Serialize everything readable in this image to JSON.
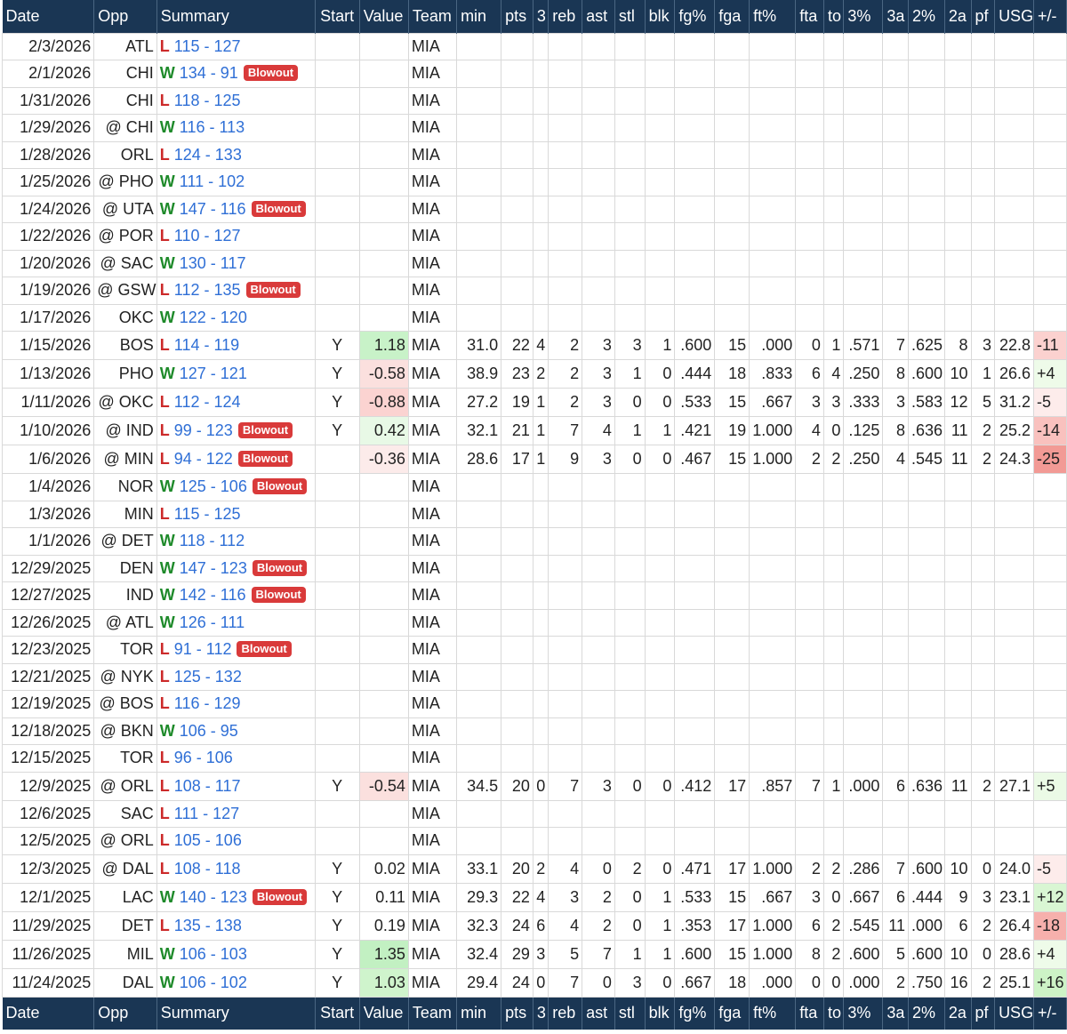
{
  "headers": [
    "Date",
    "Opp",
    "Summary",
    "Start",
    "Value",
    "Team",
    "min",
    "pts",
    "3",
    "reb",
    "ast",
    "stl",
    "blk",
    "fg%",
    "fga",
    "ft%",
    "fta",
    "to",
    "3%",
    "3a",
    "2%",
    "2a",
    "pf",
    "USG",
    "+/-"
  ],
  "colors": {
    "header_bg": "#1a3654",
    "win": "#1e8a2a",
    "loss": "#cc2a2a",
    "score": "#2f6fd6",
    "badge": "#d93a3a"
  },
  "games": [
    {
      "date": "2/3/2026",
      "opp": "ATL",
      "wl": "L",
      "score": "115 - 127",
      "badge": "",
      "start": "",
      "value": "",
      "team": "MIA",
      "min": "",
      "pts": "",
      "three": "",
      "reb": "",
      "ast": "",
      "stl": "",
      "blk": "",
      "fgp": "",
      "fga": "",
      "ftp": "",
      "fta": "",
      "to": "",
      "p3": "",
      "a3": "",
      "p2": "",
      "a2": "",
      "pf": "",
      "usg": "",
      "pm": ""
    },
    {
      "date": "2/1/2026",
      "opp": "CHI",
      "wl": "W",
      "score": "134 - 91",
      "badge": "Blowout",
      "start": "",
      "value": "",
      "team": "MIA",
      "min": "",
      "pts": "",
      "three": "",
      "reb": "",
      "ast": "",
      "stl": "",
      "blk": "",
      "fgp": "",
      "fga": "",
      "ftp": "",
      "fta": "",
      "to": "",
      "p3": "",
      "a3": "",
      "p2": "",
      "a2": "",
      "pf": "",
      "usg": "",
      "pm": ""
    },
    {
      "date": "1/31/2026",
      "opp": "CHI",
      "wl": "L",
      "score": "118 - 125",
      "badge": "",
      "start": "",
      "value": "",
      "team": "MIA",
      "min": "",
      "pts": "",
      "three": "",
      "reb": "",
      "ast": "",
      "stl": "",
      "blk": "",
      "fgp": "",
      "fga": "",
      "ftp": "",
      "fta": "",
      "to": "",
      "p3": "",
      "a3": "",
      "p2": "",
      "a2": "",
      "pf": "",
      "usg": "",
      "pm": ""
    },
    {
      "date": "1/29/2026",
      "opp": "@ CHI",
      "wl": "W",
      "score": "116 - 113",
      "badge": "",
      "start": "",
      "value": "",
      "team": "MIA",
      "min": "",
      "pts": "",
      "three": "",
      "reb": "",
      "ast": "",
      "stl": "",
      "blk": "",
      "fgp": "",
      "fga": "",
      "ftp": "",
      "fta": "",
      "to": "",
      "p3": "",
      "a3": "",
      "p2": "",
      "a2": "",
      "pf": "",
      "usg": "",
      "pm": ""
    },
    {
      "date": "1/28/2026",
      "opp": "ORL",
      "wl": "L",
      "score": "124 - 133",
      "badge": "",
      "start": "",
      "value": "",
      "team": "MIA",
      "min": "",
      "pts": "",
      "three": "",
      "reb": "",
      "ast": "",
      "stl": "",
      "blk": "",
      "fgp": "",
      "fga": "",
      "ftp": "",
      "fta": "",
      "to": "",
      "p3": "",
      "a3": "",
      "p2": "",
      "a2": "",
      "pf": "",
      "usg": "",
      "pm": ""
    },
    {
      "date": "1/25/2026",
      "opp": "@ PHO",
      "wl": "W",
      "score": "111 - 102",
      "badge": "",
      "start": "",
      "value": "",
      "team": "MIA",
      "min": "",
      "pts": "",
      "three": "",
      "reb": "",
      "ast": "",
      "stl": "",
      "blk": "",
      "fgp": "",
      "fga": "",
      "ftp": "",
      "fta": "",
      "to": "",
      "p3": "",
      "a3": "",
      "p2": "",
      "a2": "",
      "pf": "",
      "usg": "",
      "pm": ""
    },
    {
      "date": "1/24/2026",
      "opp": "@ UTA",
      "wl": "W",
      "score": "147 - 116",
      "badge": "Blowout",
      "start": "",
      "value": "",
      "team": "MIA",
      "min": "",
      "pts": "",
      "three": "",
      "reb": "",
      "ast": "",
      "stl": "",
      "blk": "",
      "fgp": "",
      "fga": "",
      "ftp": "",
      "fta": "",
      "to": "",
      "p3": "",
      "a3": "",
      "p2": "",
      "a2": "",
      "pf": "",
      "usg": "",
      "pm": ""
    },
    {
      "date": "1/22/2026",
      "opp": "@ POR",
      "wl": "L",
      "score": "110 - 127",
      "badge": "",
      "start": "",
      "value": "",
      "team": "MIA",
      "min": "",
      "pts": "",
      "three": "",
      "reb": "",
      "ast": "",
      "stl": "",
      "blk": "",
      "fgp": "",
      "fga": "",
      "ftp": "",
      "fta": "",
      "to": "",
      "p3": "",
      "a3": "",
      "p2": "",
      "a2": "",
      "pf": "",
      "usg": "",
      "pm": ""
    },
    {
      "date": "1/20/2026",
      "opp": "@ SAC",
      "wl": "W",
      "score": "130 - 117",
      "badge": "",
      "start": "",
      "value": "",
      "team": "MIA",
      "min": "",
      "pts": "",
      "three": "",
      "reb": "",
      "ast": "",
      "stl": "",
      "blk": "",
      "fgp": "",
      "fga": "",
      "ftp": "",
      "fta": "",
      "to": "",
      "p3": "",
      "a3": "",
      "p2": "",
      "a2": "",
      "pf": "",
      "usg": "",
      "pm": ""
    },
    {
      "date": "1/19/2026",
      "opp": "@ GSW",
      "wl": "L",
      "score": "112 - 135",
      "badge": "Blowout",
      "start": "",
      "value": "",
      "team": "MIA",
      "min": "",
      "pts": "",
      "three": "",
      "reb": "",
      "ast": "",
      "stl": "",
      "blk": "",
      "fgp": "",
      "fga": "",
      "ftp": "",
      "fta": "",
      "to": "",
      "p3": "",
      "a3": "",
      "p2": "",
      "a2": "",
      "pf": "",
      "usg": "",
      "pm": ""
    },
    {
      "date": "1/17/2026",
      "opp": "OKC",
      "wl": "W",
      "score": "122 - 120",
      "badge": "",
      "start": "",
      "value": "",
      "team": "MIA",
      "min": "",
      "pts": "",
      "three": "",
      "reb": "",
      "ast": "",
      "stl": "",
      "blk": "",
      "fgp": "",
      "fga": "",
      "ftp": "",
      "fta": "",
      "to": "",
      "p3": "",
      "a3": "",
      "p2": "",
      "a2": "",
      "pf": "",
      "usg": "",
      "pm": ""
    },
    {
      "date": "1/15/2026",
      "opp": "BOS",
      "wl": "L",
      "score": "114 - 119",
      "badge": "",
      "start": "Y",
      "value": "1.18",
      "value_bg": "#c8f2c8",
      "team": "MIA",
      "min": "31.0",
      "pts": "22",
      "three": "4",
      "reb": "2",
      "ast": "3",
      "stl": "3",
      "blk": "1",
      "fgp": ".600",
      "fga": "15",
      "ftp": ".000",
      "fta": "0",
      "to": "1",
      "p3": ".571",
      "a3": "7",
      "p2": ".625",
      "a2": "8",
      "pf": "3",
      "usg": "22.8",
      "pm": "-11",
      "pm_bg": "#fbd1cf"
    },
    {
      "date": "1/13/2026",
      "opp": "PHO",
      "wl": "W",
      "score": "127 - 121",
      "badge": "",
      "start": "Y",
      "value": "-0.58",
      "value_bg": "#fbe0de",
      "team": "MIA",
      "min": "38.9",
      "pts": "23",
      "three": "2",
      "reb": "2",
      "ast": "3",
      "stl": "1",
      "blk": "0",
      "fgp": ".444",
      "fga": "18",
      "ftp": ".833",
      "fta": "6",
      "to": "4",
      "p3": ".250",
      "a3": "8",
      "p2": ".600",
      "a2": "10",
      "pf": "1",
      "usg": "26.6",
      "pm": "+4",
      "pm_bg": "#eefbe9"
    },
    {
      "date": "1/11/2026",
      "opp": "@ OKC",
      "wl": "L",
      "score": "112 - 124",
      "badge": "",
      "start": "Y",
      "value": "-0.88",
      "value_bg": "#fbd3d1",
      "team": "MIA",
      "min": "27.2",
      "pts": "19",
      "three": "1",
      "reb": "2",
      "ast": "3",
      "stl": "0",
      "blk": "0",
      "fgp": ".533",
      "fga": "15",
      "ftp": ".667",
      "fta": "3",
      "to": "3",
      "p3": ".333",
      "a3": "3",
      "p2": ".583",
      "a2": "12",
      "pf": "5",
      "usg": "31.2",
      "pm": "-5",
      "pm_bg": "#fdeceb"
    },
    {
      "date": "1/10/2026",
      "opp": "@ IND",
      "wl": "L",
      "score": "99 - 123",
      "badge": "Blowout",
      "start": "Y",
      "value": "0.42",
      "value_bg": "#e8f9e6",
      "team": "MIA",
      "min": "32.1",
      "pts": "21",
      "three": "1",
      "reb": "7",
      "ast": "4",
      "stl": "1",
      "blk": "1",
      "fgp": ".421",
      "fga": "19",
      "ftp": "1.000",
      "fta": "4",
      "to": "0",
      "p3": ".125",
      "a3": "8",
      "p2": ".636",
      "a2": "11",
      "pf": "2",
      "usg": "25.2",
      "pm": "-14",
      "pm_bg": "#f9c1be"
    },
    {
      "date": "1/6/2026",
      "opp": "@ MIN",
      "wl": "L",
      "score": "94 - 122",
      "badge": "Blowout",
      "start": "",
      "value": "-0.36",
      "value_bg": "#fcebea",
      "team": "MIA",
      "min": "28.6",
      "pts": "17",
      "three": "1",
      "reb": "9",
      "ast": "3",
      "stl": "0",
      "blk": "0",
      "fgp": ".467",
      "fga": "15",
      "ftp": "1.000",
      "fta": "2",
      "to": "2",
      "p3": ".250",
      "a3": "4",
      "p2": ".545",
      "a2": "11",
      "pf": "2",
      "usg": "24.3",
      "pm": "-25",
      "pm_bg": "#f29a95"
    },
    {
      "date": "1/4/2026",
      "opp": "NOR",
      "wl": "W",
      "score": "125 - 106",
      "badge": "Blowout",
      "start": "",
      "value": "",
      "team": "MIA",
      "min": "",
      "pts": "",
      "three": "",
      "reb": "",
      "ast": "",
      "stl": "",
      "blk": "",
      "fgp": "",
      "fga": "",
      "ftp": "",
      "fta": "",
      "to": "",
      "p3": "",
      "a3": "",
      "p2": "",
      "a2": "",
      "pf": "",
      "usg": "",
      "pm": ""
    },
    {
      "date": "1/3/2026",
      "opp": "MIN",
      "wl": "L",
      "score": "115 - 125",
      "badge": "",
      "start": "",
      "value": "",
      "team": "MIA",
      "min": "",
      "pts": "",
      "three": "",
      "reb": "",
      "ast": "",
      "stl": "",
      "blk": "",
      "fgp": "",
      "fga": "",
      "ftp": "",
      "fta": "",
      "to": "",
      "p3": "",
      "a3": "",
      "p2": "",
      "a2": "",
      "pf": "",
      "usg": "",
      "pm": ""
    },
    {
      "date": "1/1/2026",
      "opp": "@ DET",
      "wl": "W",
      "score": "118 - 112",
      "badge": "",
      "start": "",
      "value": "",
      "team": "MIA",
      "min": "",
      "pts": "",
      "three": "",
      "reb": "",
      "ast": "",
      "stl": "",
      "blk": "",
      "fgp": "",
      "fga": "",
      "ftp": "",
      "fta": "",
      "to": "",
      "p3": "",
      "a3": "",
      "p2": "",
      "a2": "",
      "pf": "",
      "usg": "",
      "pm": ""
    },
    {
      "date": "12/29/2025",
      "opp": "DEN",
      "wl": "W",
      "score": "147 - 123",
      "badge": "Blowout",
      "start": "",
      "value": "",
      "team": "MIA",
      "min": "",
      "pts": "",
      "three": "",
      "reb": "",
      "ast": "",
      "stl": "",
      "blk": "",
      "fgp": "",
      "fga": "",
      "ftp": "",
      "fta": "",
      "to": "",
      "p3": "",
      "a3": "",
      "p2": "",
      "a2": "",
      "pf": "",
      "usg": "",
      "pm": ""
    },
    {
      "date": "12/27/2025",
      "opp": "IND",
      "wl": "W",
      "score": "142 - 116",
      "badge": "Blowout",
      "start": "",
      "value": "",
      "team": "MIA",
      "min": "",
      "pts": "",
      "three": "",
      "reb": "",
      "ast": "",
      "stl": "",
      "blk": "",
      "fgp": "",
      "fga": "",
      "ftp": "",
      "fta": "",
      "to": "",
      "p3": "",
      "a3": "",
      "p2": "",
      "a2": "",
      "pf": "",
      "usg": "",
      "pm": ""
    },
    {
      "date": "12/26/2025",
      "opp": "@ ATL",
      "wl": "W",
      "score": "126 - 111",
      "badge": "",
      "start": "",
      "value": "",
      "team": "MIA",
      "min": "",
      "pts": "",
      "three": "",
      "reb": "",
      "ast": "",
      "stl": "",
      "blk": "",
      "fgp": "",
      "fga": "",
      "ftp": "",
      "fta": "",
      "to": "",
      "p3": "",
      "a3": "",
      "p2": "",
      "a2": "",
      "pf": "",
      "usg": "",
      "pm": ""
    },
    {
      "date": "12/23/2025",
      "opp": "TOR",
      "wl": "L",
      "score": "91 - 112",
      "badge": "Blowout",
      "start": "",
      "value": "",
      "team": "MIA",
      "min": "",
      "pts": "",
      "three": "",
      "reb": "",
      "ast": "",
      "stl": "",
      "blk": "",
      "fgp": "",
      "fga": "",
      "ftp": "",
      "fta": "",
      "to": "",
      "p3": "",
      "a3": "",
      "p2": "",
      "a2": "",
      "pf": "",
      "usg": "",
      "pm": ""
    },
    {
      "date": "12/21/2025",
      "opp": "@ NYK",
      "wl": "L",
      "score": "125 - 132",
      "badge": "",
      "start": "",
      "value": "",
      "team": "MIA",
      "min": "",
      "pts": "",
      "three": "",
      "reb": "",
      "ast": "",
      "stl": "",
      "blk": "",
      "fgp": "",
      "fga": "",
      "ftp": "",
      "fta": "",
      "to": "",
      "p3": "",
      "a3": "",
      "p2": "",
      "a2": "",
      "pf": "",
      "usg": "",
      "pm": ""
    },
    {
      "date": "12/19/2025",
      "opp": "@ BOS",
      "wl": "L",
      "score": "116 - 129",
      "badge": "",
      "start": "",
      "value": "",
      "team": "MIA",
      "min": "",
      "pts": "",
      "three": "",
      "reb": "",
      "ast": "",
      "stl": "",
      "blk": "",
      "fgp": "",
      "fga": "",
      "ftp": "",
      "fta": "",
      "to": "",
      "p3": "",
      "a3": "",
      "p2": "",
      "a2": "",
      "pf": "",
      "usg": "",
      "pm": ""
    },
    {
      "date": "12/18/2025",
      "opp": "@ BKN",
      "wl": "W",
      "score": "106 - 95",
      "badge": "",
      "start": "",
      "value": "",
      "team": "MIA",
      "min": "",
      "pts": "",
      "three": "",
      "reb": "",
      "ast": "",
      "stl": "",
      "blk": "",
      "fgp": "",
      "fga": "",
      "ftp": "",
      "fta": "",
      "to": "",
      "p3": "",
      "a3": "",
      "p2": "",
      "a2": "",
      "pf": "",
      "usg": "",
      "pm": ""
    },
    {
      "date": "12/15/2025",
      "opp": "TOR",
      "wl": "L",
      "score": "96 - 106",
      "badge": "",
      "start": "",
      "value": "",
      "team": "MIA",
      "min": "",
      "pts": "",
      "three": "",
      "reb": "",
      "ast": "",
      "stl": "",
      "blk": "",
      "fgp": "",
      "fga": "",
      "ftp": "",
      "fta": "",
      "to": "",
      "p3": "",
      "a3": "",
      "p2": "",
      "a2": "",
      "pf": "",
      "usg": "",
      "pm": ""
    },
    {
      "date": "12/9/2025",
      "opp": "@ ORL",
      "wl": "L",
      "score": "108 - 117",
      "badge": "",
      "start": "Y",
      "value": "-0.54",
      "value_bg": "#fbe0de",
      "team": "MIA",
      "min": "34.5",
      "pts": "20",
      "three": "0",
      "reb": "7",
      "ast": "3",
      "stl": "0",
      "blk": "0",
      "fgp": ".412",
      "fga": "17",
      "ftp": ".857",
      "fta": "7",
      "to": "1",
      "p3": ".000",
      "a3": "6",
      "p2": ".636",
      "a2": "11",
      "pf": "2",
      "usg": "27.1",
      "pm": "+5",
      "pm_bg": "#ebfae6"
    },
    {
      "date": "12/6/2025",
      "opp": "SAC",
      "wl": "L",
      "score": "111 - 127",
      "badge": "",
      "start": "",
      "value": "",
      "team": "MIA",
      "min": "",
      "pts": "",
      "three": "",
      "reb": "",
      "ast": "",
      "stl": "",
      "blk": "",
      "fgp": "",
      "fga": "",
      "ftp": "",
      "fta": "",
      "to": "",
      "p3": "",
      "a3": "",
      "p2": "",
      "a2": "",
      "pf": "",
      "usg": "",
      "pm": ""
    },
    {
      "date": "12/5/2025",
      "opp": "@ ORL",
      "wl": "L",
      "score": "105 - 106",
      "badge": "",
      "start": "",
      "value": "",
      "team": "MIA",
      "min": "",
      "pts": "",
      "three": "",
      "reb": "",
      "ast": "",
      "stl": "",
      "blk": "",
      "fgp": "",
      "fga": "",
      "ftp": "",
      "fta": "",
      "to": "",
      "p3": "",
      "a3": "",
      "p2": "",
      "a2": "",
      "pf": "",
      "usg": "",
      "pm": ""
    },
    {
      "date": "12/3/2025",
      "opp": "@ DAL",
      "wl": "L",
      "score": "108 - 118",
      "badge": "",
      "start": "Y",
      "value": "0.02",
      "value_bg": "",
      "team": "MIA",
      "min": "33.1",
      "pts": "20",
      "three": "2",
      "reb": "4",
      "ast": "0",
      "stl": "2",
      "blk": "0",
      "fgp": ".471",
      "fga": "17",
      "ftp": "1.000",
      "fta": "2",
      "to": "2",
      "p3": ".286",
      "a3": "7",
      "p2": ".600",
      "a2": "10",
      "pf": "0",
      "usg": "24.0",
      "pm": "-5",
      "pm_bg": "#fdeceb"
    },
    {
      "date": "12/1/2025",
      "opp": "LAC",
      "wl": "W",
      "score": "140 - 123",
      "badge": "Blowout",
      "start": "Y",
      "value": "0.11",
      "value_bg": "",
      "team": "MIA",
      "min": "29.3",
      "pts": "22",
      "three": "4",
      "reb": "3",
      "ast": "2",
      "stl": "0",
      "blk": "1",
      "fgp": ".533",
      "fga": "15",
      "ftp": ".667",
      "fta": "3",
      "to": "0",
      "p3": ".667",
      "a3": "6",
      "p2": ".444",
      "a2": "9",
      "pf": "3",
      "usg": "23.1",
      "pm": "+12",
      "pm_bg": "#d9f6d3"
    },
    {
      "date": "11/29/2025",
      "opp": "DET",
      "wl": "L",
      "score": "135 - 138",
      "badge": "",
      "start": "Y",
      "value": "0.19",
      "value_bg": "",
      "team": "MIA",
      "min": "32.3",
      "pts": "24",
      "three": "6",
      "reb": "4",
      "ast": "2",
      "stl": "0",
      "blk": "1",
      "fgp": ".353",
      "fga": "17",
      "ftp": "1.000",
      "fta": "6",
      "to": "2",
      "p3": ".545",
      "a3": "11",
      "p2": ".000",
      "a2": "6",
      "pf": "2",
      "usg": "26.4",
      "pm": "-18",
      "pm_bg": "#f6b0ac"
    },
    {
      "date": "11/26/2025",
      "opp": "MIL",
      "wl": "W",
      "score": "106 - 103",
      "badge": "",
      "start": "Y",
      "value": "1.35",
      "value_bg": "#c2f0c2",
      "team": "MIA",
      "min": "32.4",
      "pts": "29",
      "three": "3",
      "reb": "5",
      "ast": "7",
      "stl": "1",
      "blk": "1",
      "fgp": ".600",
      "fga": "15",
      "ftp": "1.000",
      "fta": "8",
      "to": "2",
      "p3": ".600",
      "a3": "5",
      "p2": ".600",
      "a2": "10",
      "pf": "0",
      "usg": "28.6",
      "pm": "+4",
      "pm_bg": "#eefbe9"
    },
    {
      "date": "11/24/2025",
      "opp": "DAL",
      "wl": "W",
      "score": "106 - 102",
      "badge": "",
      "start": "Y",
      "value": "1.03",
      "value_bg": "#cff4cc",
      "team": "MIA",
      "min": "29.4",
      "pts": "24",
      "three": "0",
      "reb": "7",
      "ast": "0",
      "stl": "3",
      "blk": "0",
      "fgp": ".667",
      "fga": "18",
      "ftp": ".000",
      "fta": "0",
      "to": "0",
      "p3": ".000",
      "a3": "2",
      "p2": ".750",
      "a2": "16",
      "pf": "2",
      "usg": "25.1",
      "pm": "+16",
      "pm_bg": "#cdf3c6"
    }
  ]
}
